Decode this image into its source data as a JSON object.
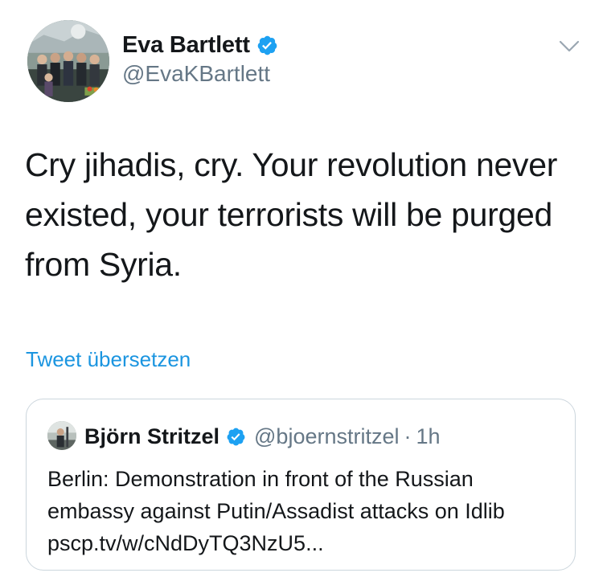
{
  "tweet": {
    "author": {
      "name": "Eva Bartlett",
      "handle": "@EvaKBartlett",
      "verified": true
    },
    "text": "Cry jihadis, cry. Your revolution never existed, your terrorists will be purged from Syria.",
    "translate_label": "Tweet übersetzen",
    "menu_icon": "chevron-down-icon"
  },
  "quoted_tweet": {
    "author": {
      "name": "Björn Stritzel",
      "handle": "@bjoernstritzel",
      "verified": true
    },
    "separator": "·",
    "time": "1h",
    "text": "Berlin: Demonstration in front of the Russian embassy against Putin/Assadist attacks on Idlib pscp.tv/w/cNdDyTQ3NzU5..."
  },
  "colors": {
    "link_blue": "#1b95e0",
    "verified_blue": "#1da1f2",
    "secondary_text": "#657786",
    "border": "#ccd6dd"
  }
}
